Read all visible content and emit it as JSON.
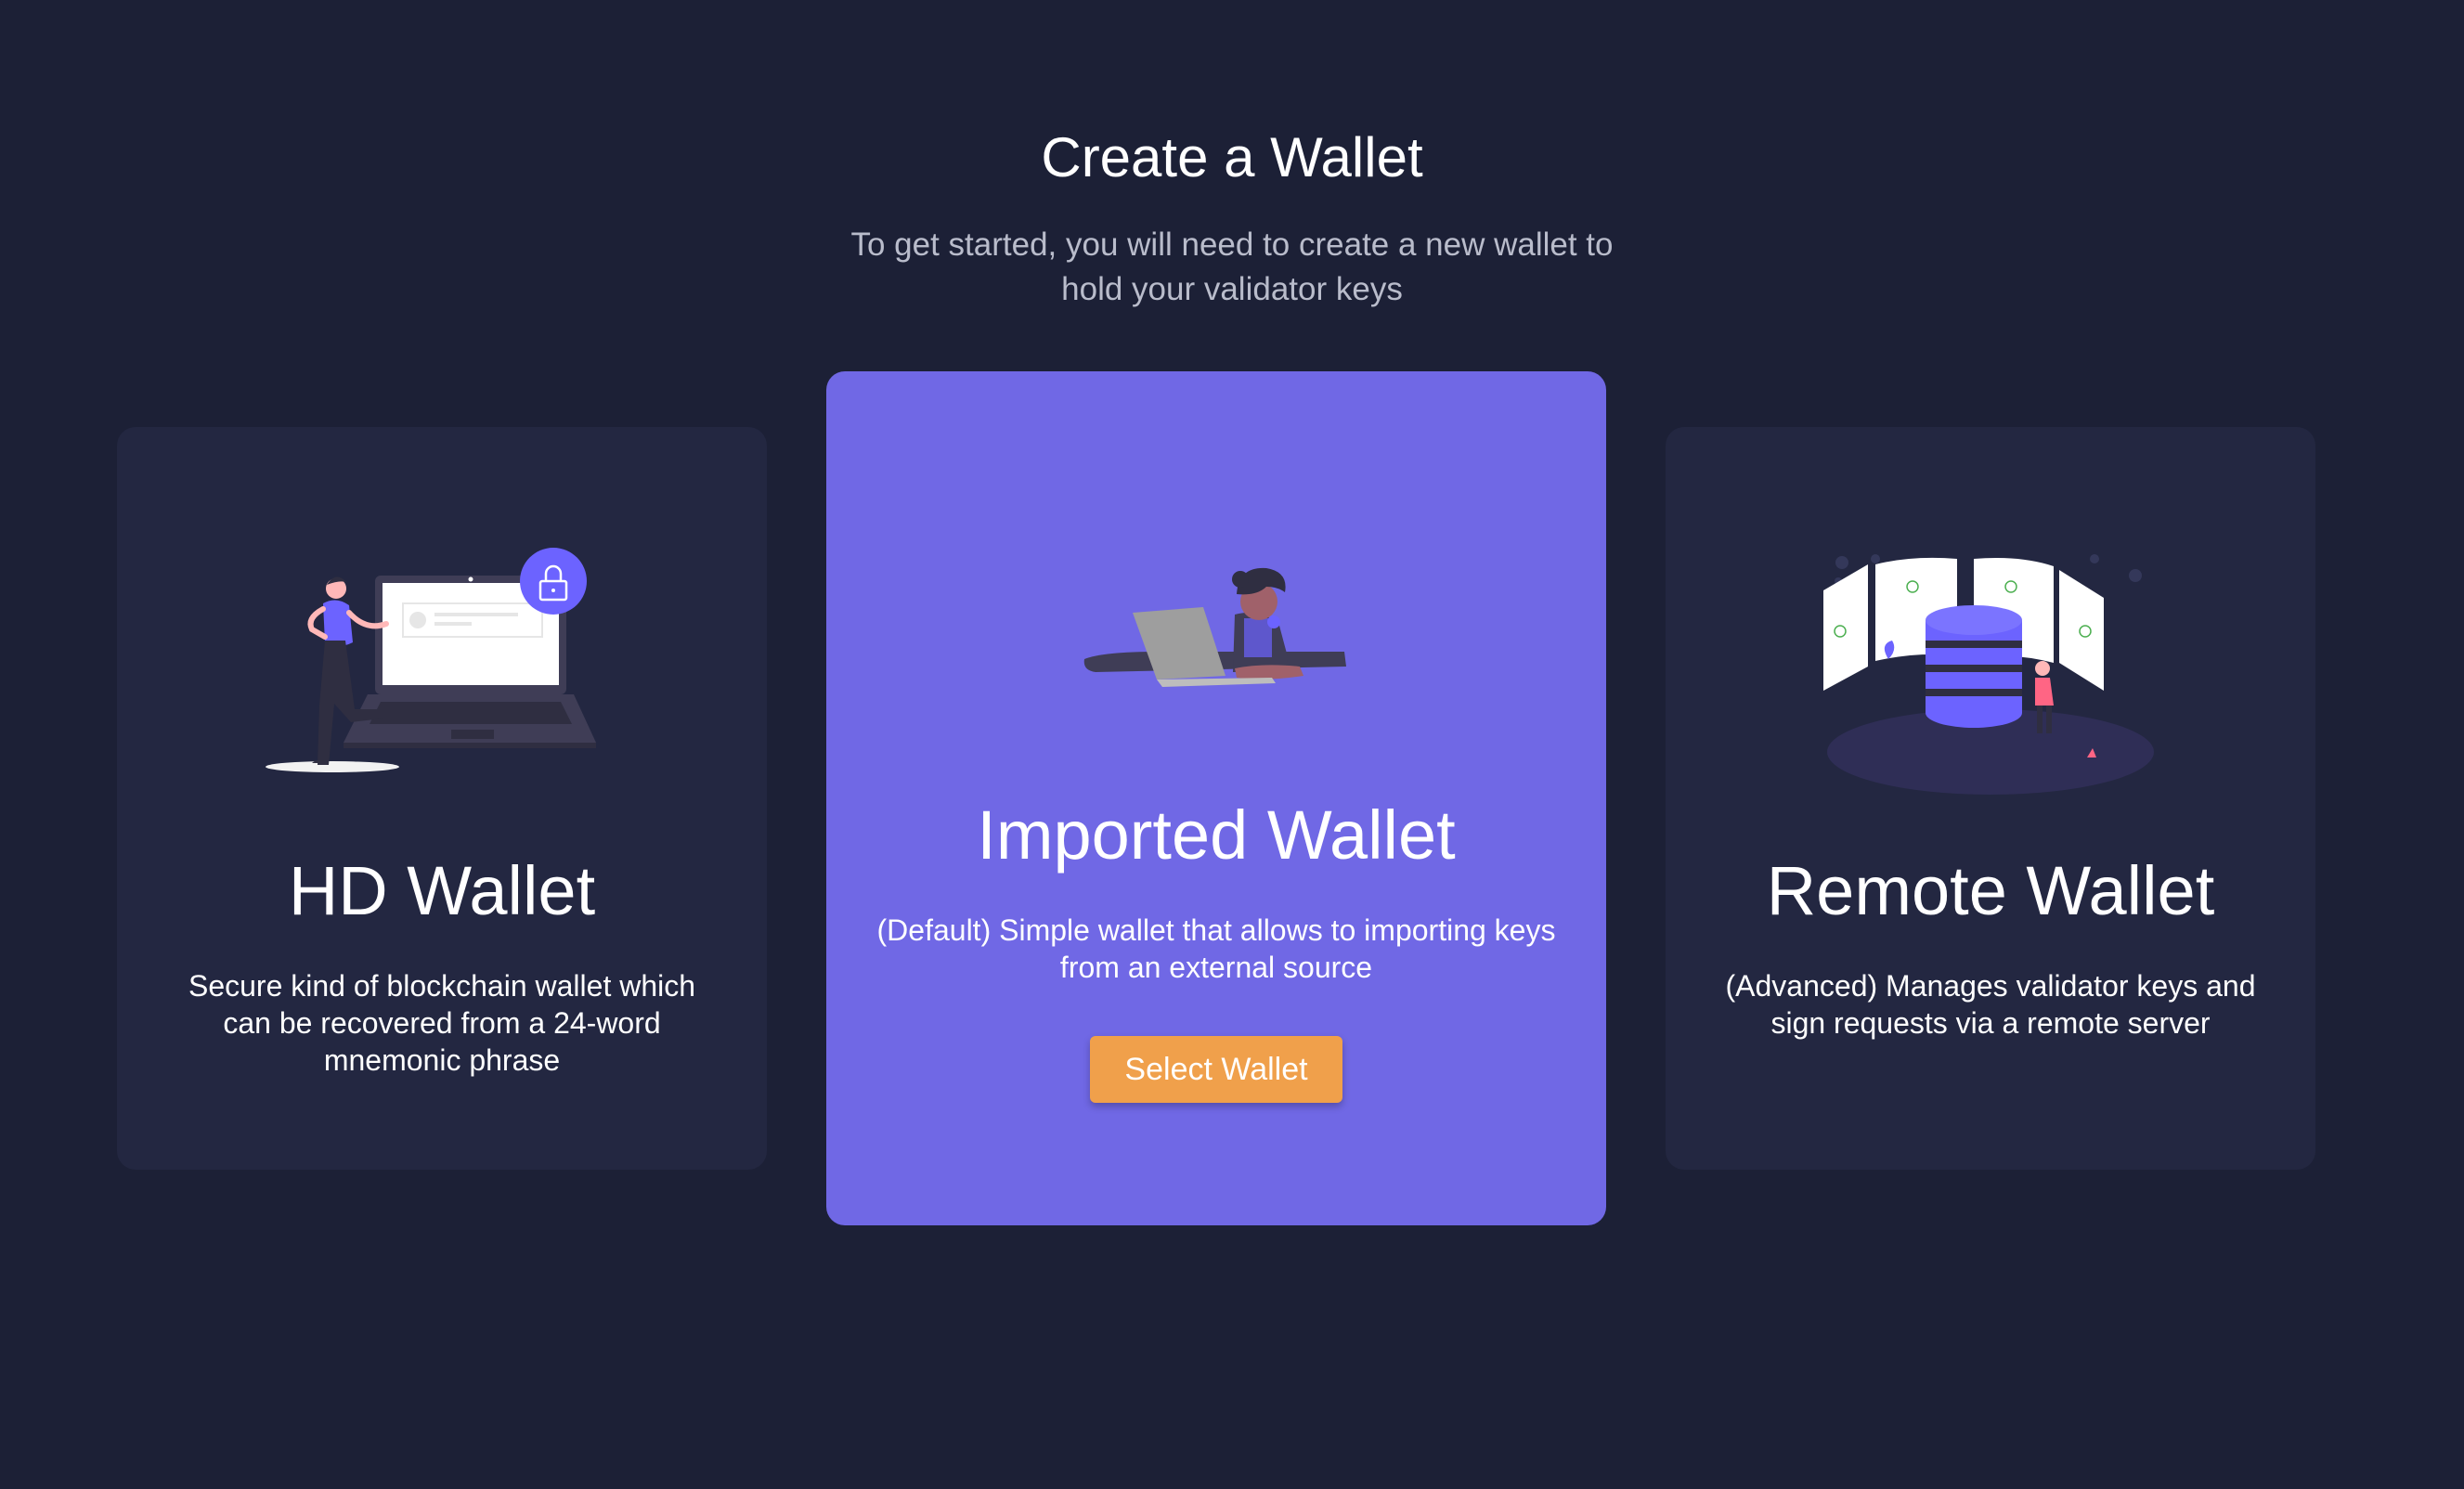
{
  "header": {
    "title": "Create a Wallet",
    "subtitle": "To get started, you will need to create a new wallet to hold your validator keys"
  },
  "cards": [
    {
      "title": "HD Wallet",
      "description": "Secure kind of blockchain wallet which can be recovered from a 24-word mnemonic phrase",
      "illustration": "laptop-lock-illustration"
    },
    {
      "title": "Imported Wallet",
      "description": "(Default) Simple wallet that allows to importing keys from an external source",
      "illustration": "person-laptop-illustration",
      "button_label": "Select Wallet"
    },
    {
      "title": "Remote Wallet",
      "description": "(Advanced) Manages validator keys and sign requests via a remote server",
      "illustration": "server-database-illustration"
    }
  ],
  "colors": {
    "background": "#1c2036",
    "card": "#232741",
    "featured_card": "#7068e5",
    "button": "#f0a04b"
  }
}
